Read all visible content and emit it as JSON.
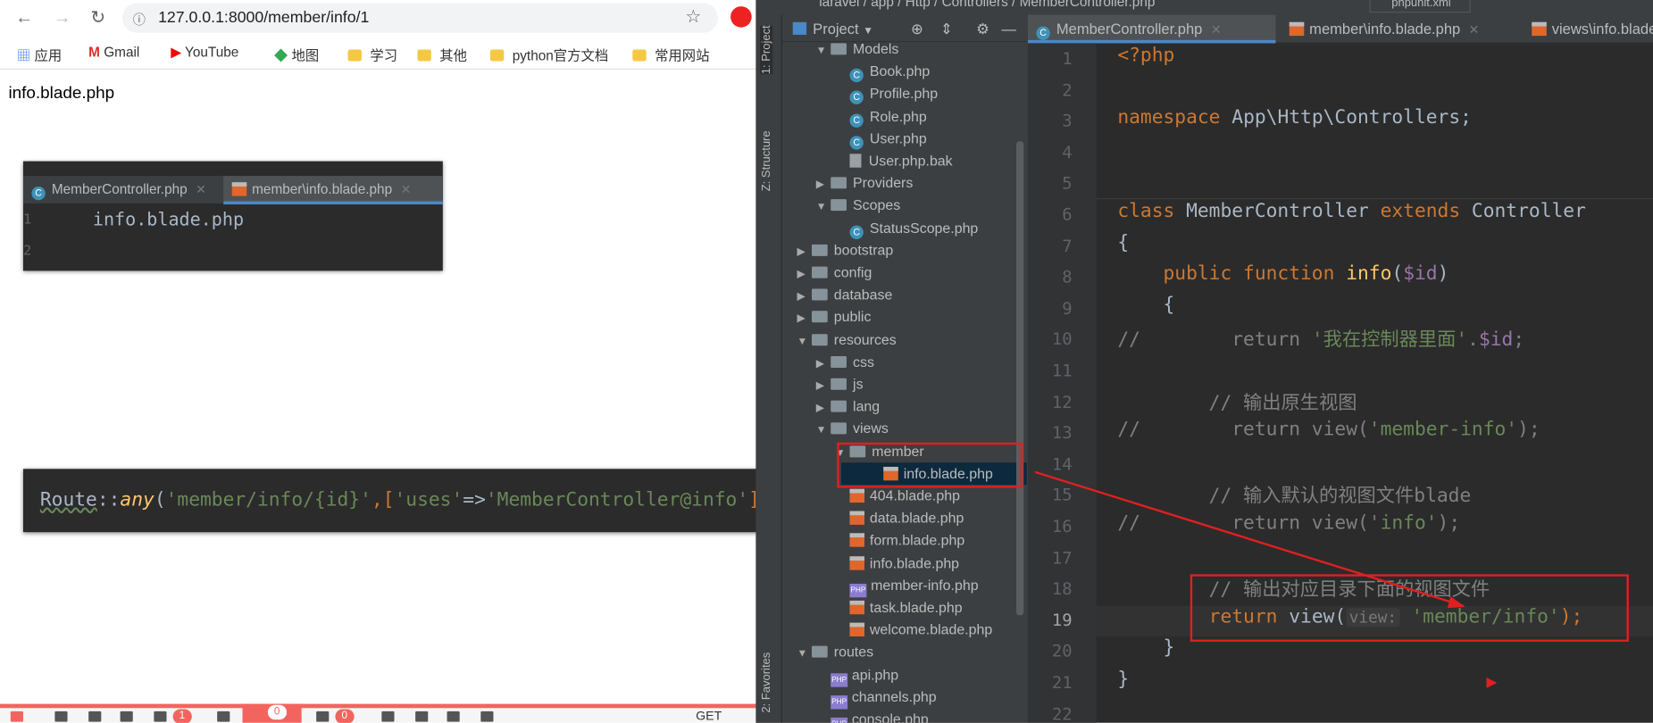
{
  "browser": {
    "url": "127.0.0.1:8000/member/info/1",
    "bookmarks": [
      "应用",
      "Gmail",
      "YouTube",
      "地图",
      "学习",
      "其他",
      "python官方文档",
      "常用网站"
    ],
    "page_text": "info.blade.php",
    "debugbar": {
      "badges": [
        "1",
        "0",
        "0"
      ],
      "request_label": "GET"
    }
  },
  "overlay1": {
    "tabs": [
      "MemberController.php",
      "member\\info.blade.php"
    ],
    "lines": [
      {
        "n": "1",
        "text": "info.blade.php"
      },
      {
        "n": "2",
        "text": ""
      }
    ]
  },
  "overlay2": {
    "route": "Route",
    "sep": "::",
    "method": "any",
    "p1": "(",
    "arg1": "'member/info/{id}'",
    "p2": ",[",
    "key": "'uses'",
    "arrow": "=>",
    "val": "'MemberController@info'",
    "p3": "]);"
  },
  "ide": {
    "breadcrumb": "laravel / app / Http / Controllers / MemberController.php",
    "run_config": "phpunit.xml",
    "side_tabs": {
      "project": "1: Project",
      "structure": "Z: Structure",
      "favorites": "2: Favorites"
    },
    "project_header": "Project",
    "tree": [
      {
        "label": "Models",
        "type": "folder",
        "depth": 1,
        "open": true
      },
      {
        "label": "Book.php",
        "type": "class",
        "depth": 2
      },
      {
        "label": "Profile.php",
        "type": "class",
        "depth": 2
      },
      {
        "label": "Role.php",
        "type": "class",
        "depth": 2
      },
      {
        "label": "User.php",
        "type": "class",
        "depth": 2
      },
      {
        "label": "User.php.bak",
        "type": "file",
        "depth": 2
      },
      {
        "label": "Providers",
        "type": "folder",
        "depth": 1,
        "open": false
      },
      {
        "label": "Scopes",
        "type": "folder",
        "depth": 1,
        "open": true
      },
      {
        "label": "StatusScope.php",
        "type": "class",
        "depth": 2
      },
      {
        "label": "bootstrap",
        "type": "folder",
        "depth": 0,
        "open": false
      },
      {
        "label": "config",
        "type": "folder",
        "depth": 0,
        "open": false
      },
      {
        "label": "database",
        "type": "folder",
        "depth": 0,
        "open": false
      },
      {
        "label": "public",
        "type": "folder",
        "depth": 0,
        "open": false
      },
      {
        "label": "resources",
        "type": "folder",
        "depth": 0,
        "open": true
      },
      {
        "label": "css",
        "type": "folder",
        "depth": 1,
        "open": false
      },
      {
        "label": "js",
        "type": "folder",
        "depth": 1,
        "open": false
      },
      {
        "label": "lang",
        "type": "folder",
        "depth": 1,
        "open": false
      },
      {
        "label": "views",
        "type": "folder",
        "depth": 1,
        "open": true
      },
      {
        "label": "member",
        "type": "folder",
        "depth": 2,
        "open": true
      },
      {
        "label": "info.blade.php",
        "type": "blade",
        "depth": 3,
        "selected": true
      },
      {
        "label": "404.blade.php",
        "type": "blade",
        "depth": 2
      },
      {
        "label": "data.blade.php",
        "type": "blade",
        "depth": 2
      },
      {
        "label": "form.blade.php",
        "type": "blade",
        "depth": 2
      },
      {
        "label": "info.blade.php",
        "type": "blade",
        "depth": 2
      },
      {
        "label": "member-info.php",
        "type": "php",
        "depth": 2
      },
      {
        "label": "task.blade.php",
        "type": "blade",
        "depth": 2
      },
      {
        "label": "welcome.blade.php",
        "type": "blade",
        "depth": 2
      },
      {
        "label": "routes",
        "type": "folder",
        "depth": 0,
        "open": true
      },
      {
        "label": "api.php",
        "type": "php",
        "depth": 1
      },
      {
        "label": "channels.php",
        "type": "php",
        "depth": 1
      },
      {
        "label": "console.php",
        "type": "php",
        "depth": 1
      }
    ],
    "tabs": [
      "MemberController.php",
      "member\\info.blade.php",
      "views\\info.blade.php"
    ],
    "code": {
      "l1": "<?php",
      "l3a": "namespace",
      "l3b": " App\\Http\\Controllers;",
      "l6a": "class",
      "l6b": " MemberController ",
      "l6c": "extends",
      "l6d": " Controller",
      "l7": "{",
      "l8a": "    public function ",
      "l8b": "info",
      "l8c": "(",
      "l8d": "$id",
      "l8e": ")",
      "l9": "    {",
      "l10a": "//        return ",
      "l10b": "'我在控制器里面'",
      "l10c": ".",
      "l10d": "$id",
      "l10e": ";",
      "l12": "        // 输出原生视图",
      "l13a": "//        return view(",
      "l13b": "'member-info'",
      "l13c": ");",
      "l15": "        // 输入默认的视图文件blade",
      "l16a": "//        return view(",
      "l16b": "'info'",
      "l16c": ");",
      "l18": "        // 输出对应目录下面的视图文件",
      "l19a": "        return ",
      "l19b": "view(",
      "l19hint": "view:",
      "l19c": "'member/info'",
      "l19d": ");",
      "l20": "    }",
      "l21": "}"
    },
    "line_count": 22
  },
  "colors": {
    "annotation": "#e02020",
    "accent": "#4a88c7"
  }
}
